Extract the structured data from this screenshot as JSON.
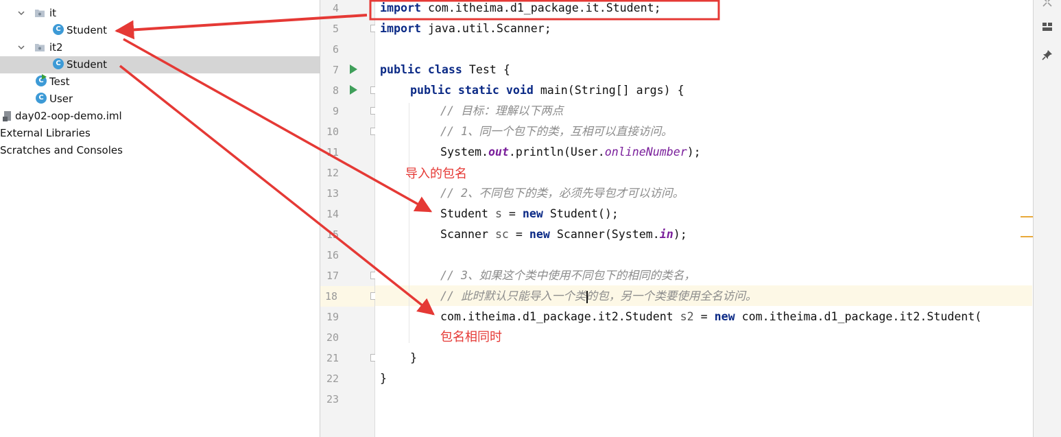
{
  "project_tree": {
    "items": [
      {
        "label": "it",
        "kind": "package"
      },
      {
        "label": "Student",
        "kind": "class"
      },
      {
        "label": "it2",
        "kind": "package"
      },
      {
        "label": "Student",
        "kind": "class",
        "selected": true
      },
      {
        "label": "Test",
        "kind": "runnable-class"
      },
      {
        "label": "User",
        "kind": "class"
      },
      {
        "label": "day02-oop-demo.iml",
        "kind": "module-file"
      },
      {
        "label": "External Libraries",
        "kind": "libraries"
      },
      {
        "label": "Scratches and Consoles",
        "kind": "scratches"
      }
    ],
    "class_icon_letter": "C"
  },
  "editor": {
    "line_numbers": [
      "4",
      "5",
      "6",
      "7",
      "8",
      "9",
      "10",
      "11",
      "12",
      "13",
      "14",
      "15",
      "16",
      "17",
      "18",
      "19",
      "20",
      "21",
      "22",
      "23"
    ],
    "code": {
      "l4_kw": "import",
      "l4_rest": " com.itheima.d1_package.it.Student;",
      "l5_kw": "import",
      "l5_rest": " java.util.Scanner;",
      "l7_kw": "public class",
      "l7_rest": " Test {",
      "l8_kw": "public static void",
      "l8_rest": " main(String[] args) {",
      "l9": "// 目标：理解以下两点",
      "l10": "// 1、同一个包下的类，互相可以直接访问。",
      "l11_a": "System.",
      "l11_out": "out",
      "l11_b": ".println(User.",
      "l11_fld": "onlineNumber",
      "l11_c": ");",
      "l13": "// 2、不同包下的类，必须先导包才可以访问。",
      "l14_a": "Student ",
      "l14_var": "s",
      "l14_b": " = ",
      "l14_kw": "new",
      "l14_c": " Student();",
      "l15_a": "Scanner ",
      "l15_var": "sc",
      "l15_b": " = ",
      "l15_kw": "new",
      "l15_c": " Scanner(System.",
      "l15_in": "in",
      "l15_d": ");",
      "l17": "// 3、如果这个类中使用不同包下的相同的类名，",
      "l18": "// 此时默认只能导入一个类的包，另一个类要使用全名访问。",
      "l19_a": "com.itheima.d1_package.it2.Student ",
      "l19_var": "s2",
      "l19_b": " = ",
      "l19_kw": "new",
      "l19_c": " com.itheima.d1_package.it2.Student(",
      "l21": "}",
      "l22": "}"
    },
    "highlighted_line": "18"
  },
  "annotations": {
    "imported_package_name": "导入的包名",
    "same_package_name": "包名相同时"
  },
  "colors": {
    "annotation_red": "#e53935",
    "keyword": "#0b2a86",
    "comment": "#8c8c8c",
    "static_field": "#7a1f9b",
    "selection": "#d5d5d5",
    "run_green": "#3f9f5a"
  }
}
